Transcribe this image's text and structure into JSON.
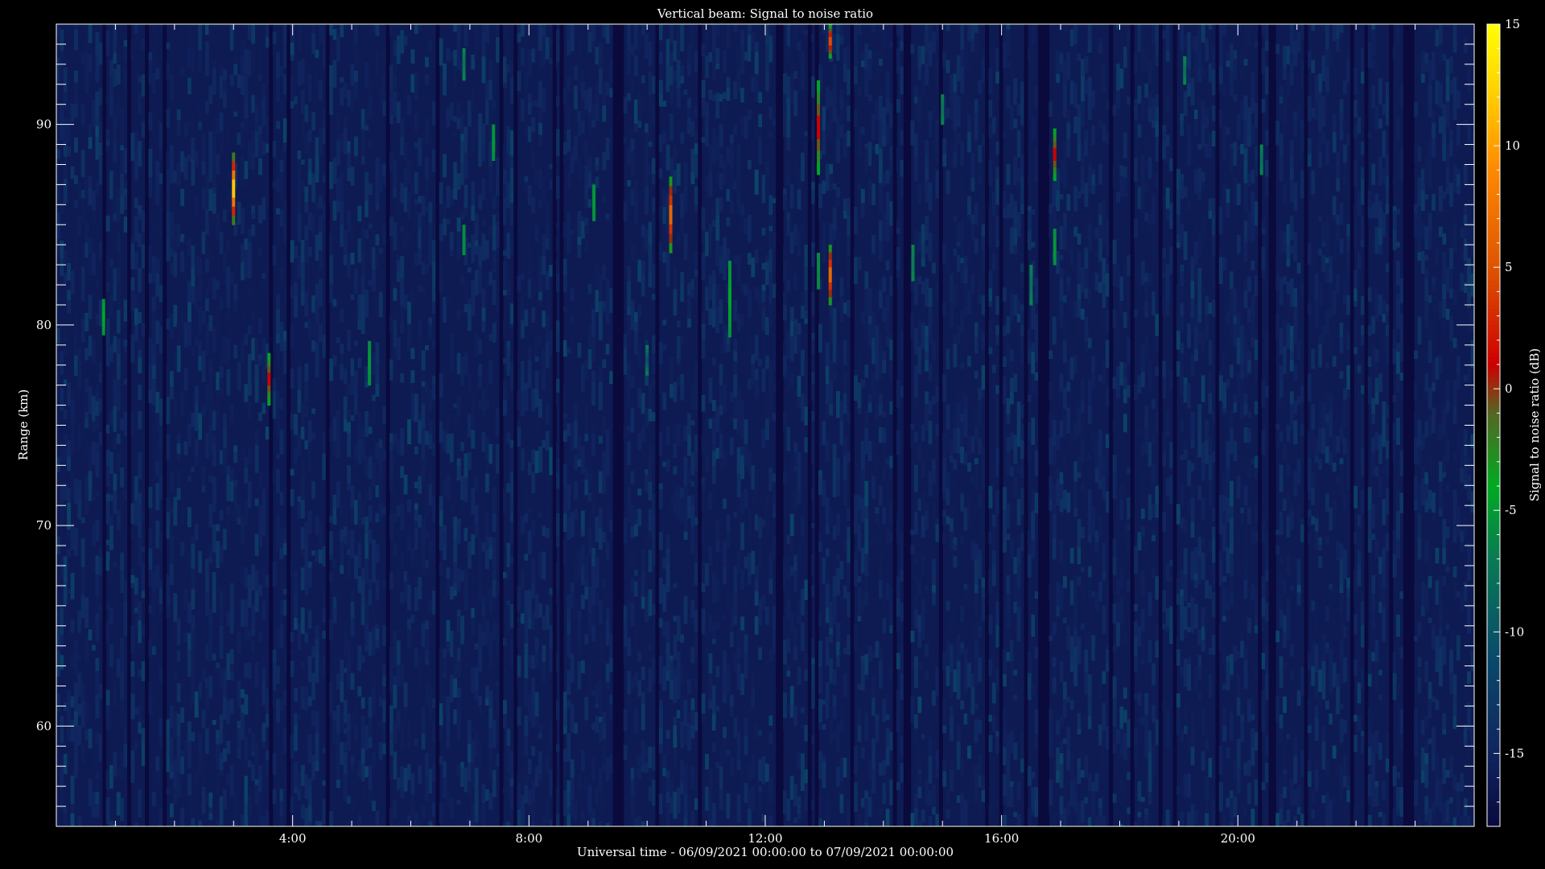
{
  "chart_data": {
    "type": "heatmap",
    "title": "Vertical beam: Signal to noise ratio",
    "xlabel": "Universal time - 06/09/2021 00:00:00 to 07/09/2021 00:00:00",
    "ylabel": "Range (km)",
    "colorbar_label": "Signal to noise ratio (dB)",
    "xlim_hours": [
      0,
      24
    ],
    "ylim_km": [
      55,
      95
    ],
    "x_ticks": [
      {
        "hour": 4,
        "label": "4:00"
      },
      {
        "hour": 8,
        "label": "8:00"
      },
      {
        "hour": 12,
        "label": "12:00"
      },
      {
        "hour": 16,
        "label": "16:00"
      },
      {
        "hour": 20,
        "label": "20:00"
      }
    ],
    "y_ticks": [
      {
        "km": 60,
        "label": "60"
      },
      {
        "km": 70,
        "label": "70"
      },
      {
        "km": 80,
        "label": "80"
      },
      {
        "km": 90,
        "label": "90"
      }
    ],
    "colorbar_range_db": [
      -18,
      15
    ],
    "colorbar_ticks": [
      {
        "db": 15,
        "label": "15"
      },
      {
        "db": 10,
        "label": "10"
      },
      {
        "db": 5,
        "label": "5"
      },
      {
        "db": 0,
        "label": "0"
      },
      {
        "db": -5,
        "label": "-5"
      },
      {
        "db": -10,
        "label": "-10"
      },
      {
        "db": -15,
        "label": "-15"
      }
    ],
    "background_db": -16,
    "colormap": [
      {
        "db": -18,
        "color": "#0a0a3c"
      },
      {
        "db": -15,
        "color": "#10245e"
      },
      {
        "db": -11,
        "color": "#0a4a6a"
      },
      {
        "db": -7,
        "color": "#0a7a55"
      },
      {
        "db": -4,
        "color": "#00aa22"
      },
      {
        "db": -1,
        "color": "#556622"
      },
      {
        "db": 1,
        "color": "#cc0000"
      },
      {
        "db": 5,
        "color": "#dd5500"
      },
      {
        "db": 9,
        "color": "#ff8800"
      },
      {
        "db": 12,
        "color": "#ffcc00"
      },
      {
        "db": 15,
        "color": "#ffff00"
      }
    ],
    "echoes": [
      {
        "hour": 0.8,
        "km_from": 79.5,
        "km_to": 81.3,
        "peak_db": -4
      },
      {
        "hour": 3.0,
        "km_from": 85.0,
        "km_to": 88.6,
        "peak_db": 14
      },
      {
        "hour": 3.6,
        "km_from": 76.0,
        "km_to": 78.6,
        "peak_db": 2
      },
      {
        "hour": 5.3,
        "km_from": 77.0,
        "km_to": 79.2,
        "peak_db": -5
      },
      {
        "hour": 6.9,
        "km_from": 83.5,
        "km_to": 85.0,
        "peak_db": -6
      },
      {
        "hour": 6.9,
        "km_from": 92.2,
        "km_to": 93.8,
        "peak_db": -8
      },
      {
        "hour": 7.4,
        "km_from": 88.2,
        "km_to": 90.0,
        "peak_db": -5
      },
      {
        "hour": 9.1,
        "km_from": 85.2,
        "km_to": 87.0,
        "peak_db": -5
      },
      {
        "hour": 10.4,
        "km_from": 83.6,
        "km_to": 87.4,
        "peak_db": 8
      },
      {
        "hour": 11.4,
        "km_from": 79.4,
        "km_to": 83.2,
        "peak_db": -4
      },
      {
        "hour": 12.9,
        "km_from": 81.8,
        "km_to": 83.6,
        "peak_db": -6
      },
      {
        "hour": 12.9,
        "km_from": 87.5,
        "km_to": 92.2,
        "peak_db": 2
      },
      {
        "hour": 13.1,
        "km_from": 81.0,
        "km_to": 84.0,
        "peak_db": 8
      },
      {
        "hour": 13.1,
        "km_from": 93.3,
        "km_to": 95.0,
        "peak_db": 6
      },
      {
        "hour": 14.5,
        "km_from": 82.2,
        "km_to": 84.0,
        "peak_db": -7
      },
      {
        "hour": 15.0,
        "km_from": 90.0,
        "km_to": 91.5,
        "peak_db": -8
      },
      {
        "hour": 16.5,
        "km_from": 81.0,
        "km_to": 83.0,
        "peak_db": -8
      },
      {
        "hour": 16.9,
        "km_from": 87.2,
        "km_to": 89.8,
        "peak_db": 2
      },
      {
        "hour": 16.9,
        "km_from": 83.0,
        "km_to": 84.8,
        "peak_db": -5
      },
      {
        "hour": 19.1,
        "km_from": 92.0,
        "km_to": 93.4,
        "peak_db": -8
      },
      {
        "hour": 20.4,
        "km_from": 87.5,
        "km_to": 89.0,
        "peak_db": -8
      },
      {
        "hour": 10.0,
        "km_from": 77.5,
        "km_to": 79.0,
        "peak_db": -11
      }
    ],
    "grid": false,
    "colorbar_position": "right"
  }
}
